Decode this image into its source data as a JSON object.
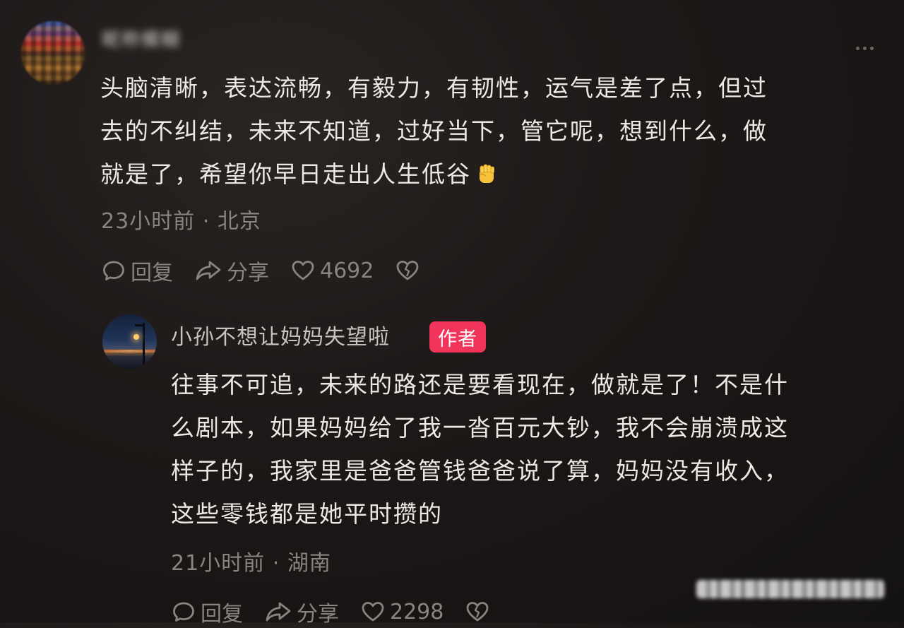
{
  "comment": {
    "username": "昵称模糊",
    "text_lines": [
      "头脑清晰，表达流畅，有毅力，有韧性，运气是差了点，但过",
      "去的不纠结，未来不知道，过好当下，管它呢，想到什么，做",
      "就是了，希望你早日走出人生低谷"
    ],
    "emoji_icon": "raised-fist-icon",
    "time": "23小时前",
    "separator": "·",
    "location": "北京",
    "actions": {
      "reply_label": "回复",
      "share_label": "分享",
      "like_count": "4692"
    }
  },
  "reply": {
    "username": "小孙不想让妈妈失望啦",
    "badge": "作者",
    "text_lines": [
      "往事不可追，未来的路还是要看现在，做就是了！不是什",
      "么剧本，如果妈妈给了我一沓百元大钞，我不会崩溃成这",
      "样子的，我家里是爸爸管钱爸爸说了算，妈妈没有收入，",
      "这些零钱都是她平时攒的"
    ],
    "time": "21小时前",
    "separator": "·",
    "location": "湖南",
    "actions": {
      "reply_label": "回复",
      "share_label": "分享",
      "like_count": "2298"
    }
  },
  "colors": {
    "badge_bg": "#f0345a",
    "text": "#ece8e5",
    "meta": "#8a8480",
    "background": "#1c1817"
  }
}
